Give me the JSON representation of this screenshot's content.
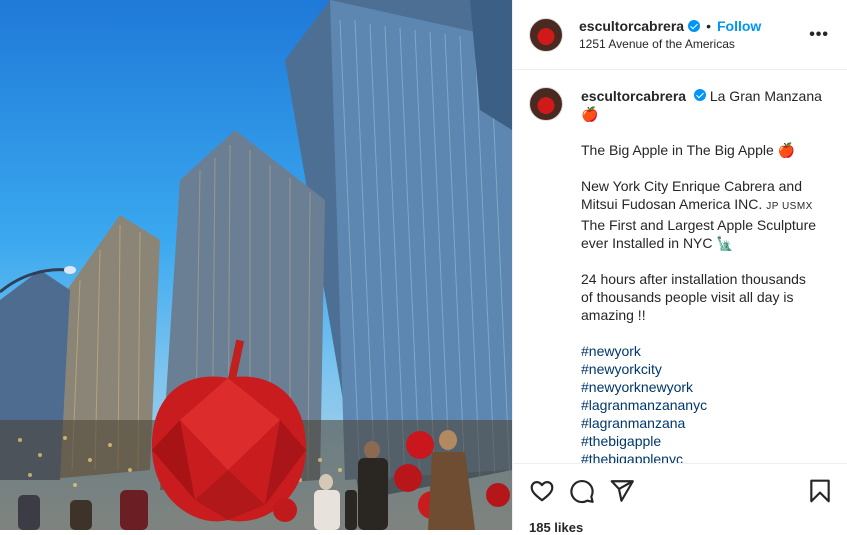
{
  "post": {
    "username": "escultorcabrera",
    "follow_label": "Follow",
    "separator": "•",
    "location": "1251 Avenue of the Americas",
    "more_label": "•••"
  },
  "caption": {
    "username": "escultorcabrera",
    "title": "La Gran Manzana",
    "apple_emoji": "🍎",
    "line_big_apple": "The Big Apple in The Big Apple",
    "line_ny1": "New York City Enrique Cabrera and",
    "line_ny2": "Mitsui Fudosan America INC.",
    "flags": "JP USMX",
    "line_first1": "The First and Largest Apple Sculpture",
    "line_first2": "ever Installed in NYC",
    "statue_emoji": "🗽",
    "line_24a": "24 hours after installation thousands",
    "line_24b": "of thousands people visit all day is",
    "line_24c": "amazing !!",
    "hashtags": [
      "#newyork",
      "#newyorkcity",
      "#newyorknewyork",
      "#lagranmanzananyc",
      "#lagranmanzana",
      "#thebigapple",
      "#thebigapplenyc"
    ]
  },
  "actions": {
    "like_icon": "heart-icon",
    "comment_icon": "comment-icon",
    "share_icon": "send-icon",
    "save_icon": "bookmark-icon",
    "likes_text": "185 likes"
  },
  "colors": {
    "accent": "#0095f6",
    "hashtag": "#00376b",
    "text": "#262626"
  }
}
